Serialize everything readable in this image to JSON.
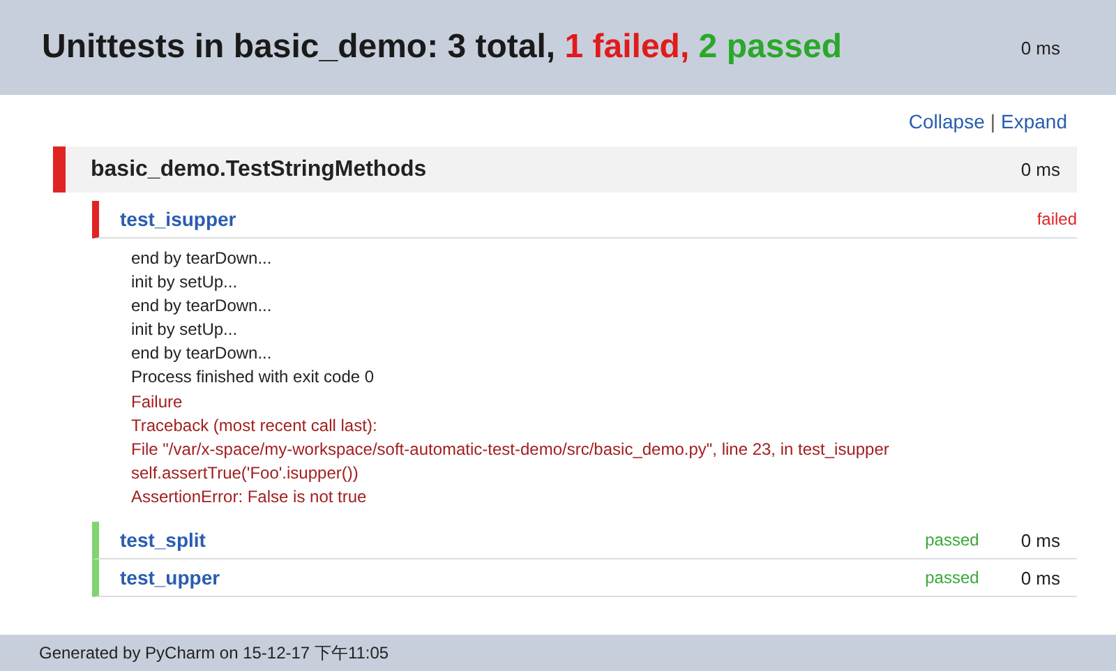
{
  "header": {
    "title": "Unittests in basic_demo: 3 total,",
    "failed_count": "1 failed,",
    "passed_count": "2 passed",
    "duration": "0 ms"
  },
  "links": [
    {
      "label": "Collapse"
    },
    {
      "label": "Expand"
    }
  ],
  "link_separator": "|",
  "suite": {
    "name": "basic_demo.TestStringMethods",
    "failed": true,
    "duration": "0 ms",
    "tests": [
      {
        "name": "test_isupper",
        "failed": true,
        "status_label": "failed",
        "output": [
          {
            "kind": "stdout",
            "text": "end by tearDown..."
          },
          {
            "kind": "stdout",
            "text": "init by setUp..."
          },
          {
            "kind": "stdout",
            "text": "end by tearDown..."
          },
          {
            "kind": "stdout",
            "text": "init by setUp..."
          },
          {
            "kind": "stdout",
            "text": "end by tearDown..."
          },
          {
            "kind": "stdout",
            "text": "Process finished with exit code 0"
          },
          {
            "kind": "error",
            "text": "Failure"
          },
          {
            "kind": "error",
            "text": "Traceback (most recent call last):"
          },
          {
            "kind": "error",
            "text": "File \"/var/x-space/my-workspace/soft-automatic-test-demo/src/basic_demo.py\", line 23, in test_isupper"
          },
          {
            "kind": "error",
            "text": "self.assertTrue('Foo'.isupper())"
          },
          {
            "kind": "error",
            "text": "AssertionError: False is not true"
          }
        ]
      },
      {
        "name": "test_split",
        "failed": false,
        "status_label": "passed",
        "duration": "0 ms"
      },
      {
        "name": "test_upper",
        "failed": false,
        "status_label": "passed",
        "duration": "0 ms"
      }
    ]
  },
  "footer": {
    "text": "Generated by PyCharm on 15-12-17 下午11:05"
  }
}
